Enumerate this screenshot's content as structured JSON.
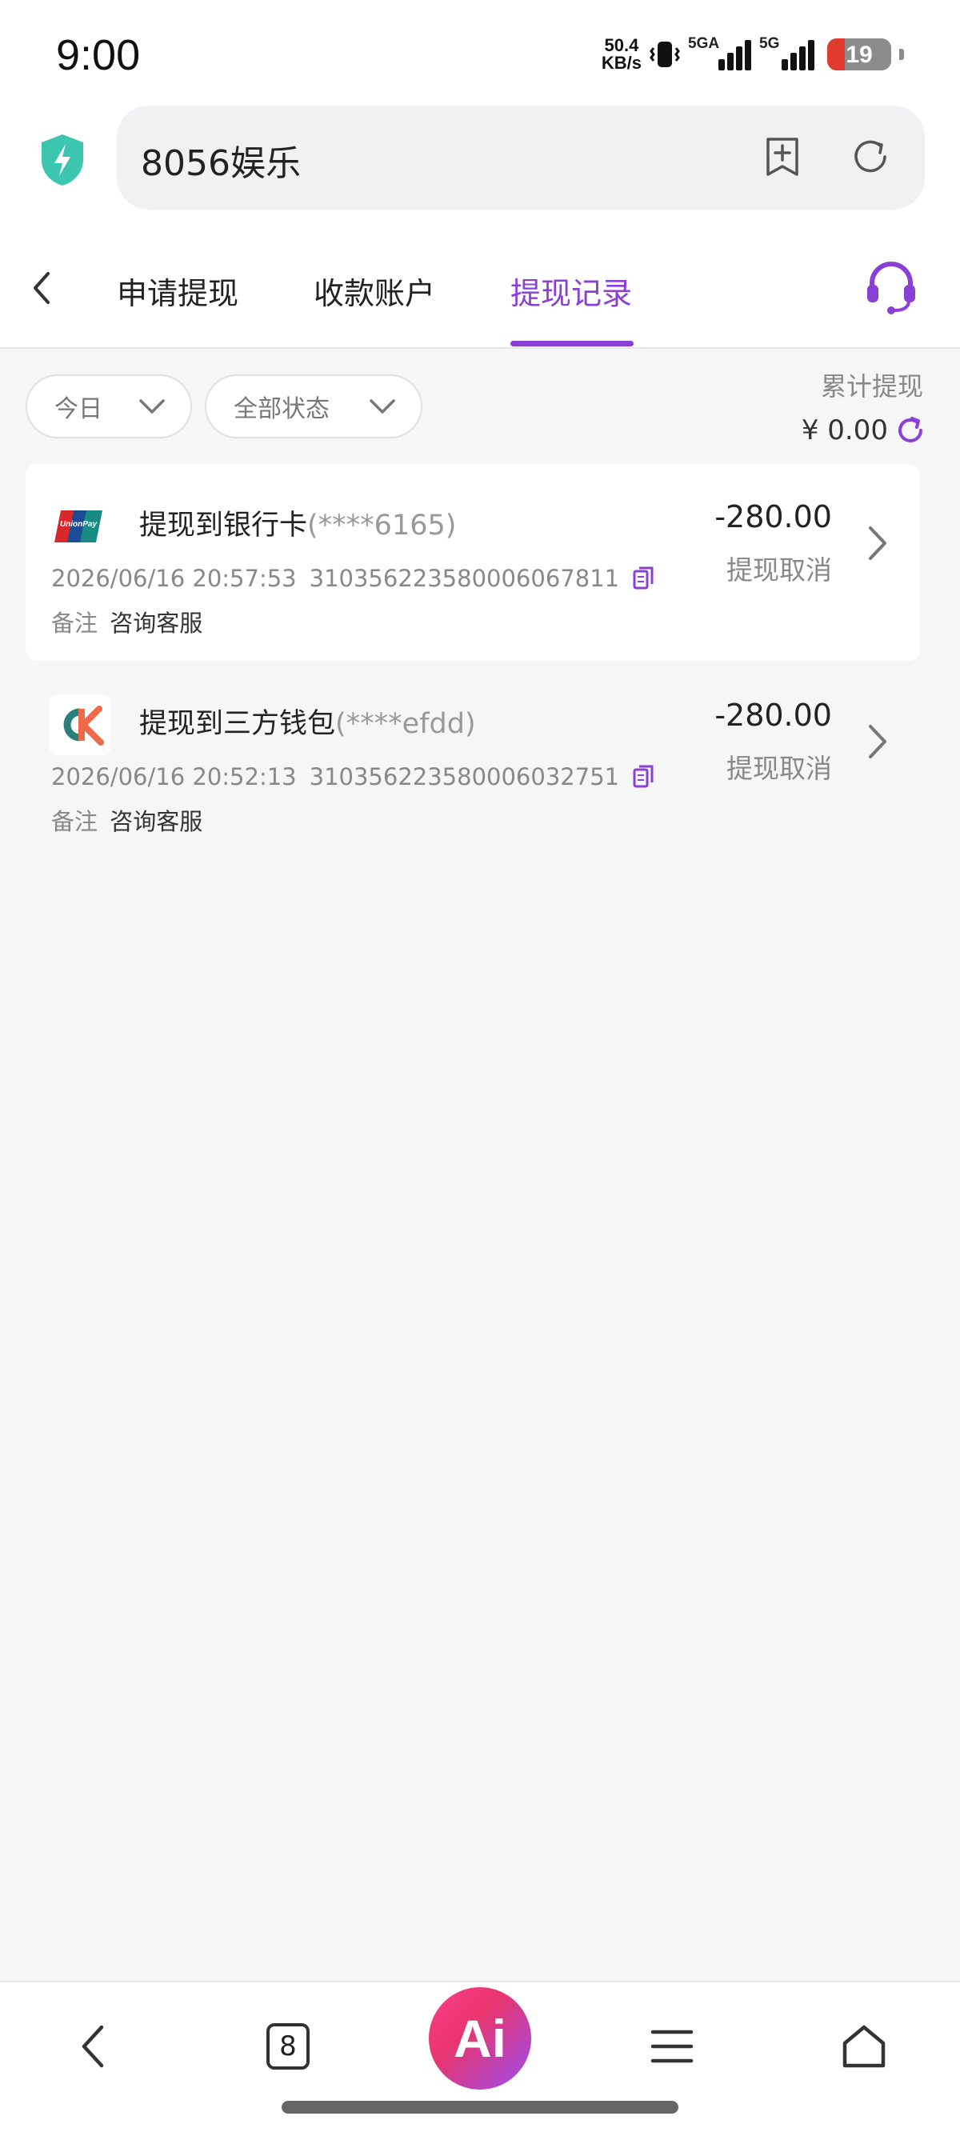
{
  "status_bar": {
    "time": "9:00",
    "net_speed_value": "50.4",
    "net_speed_unit": "KB/s",
    "signal1_label": "5GA",
    "signal2_label": "5G",
    "battery": "19",
    "battery_level": 0.19,
    "battery_low_color": "#e23a2f"
  },
  "browser": {
    "address": "8056娱乐",
    "shield_color": "#3cc6b0"
  },
  "tabs": [
    {
      "label": "申请提现",
      "active": false
    },
    {
      "label": "收款账户",
      "active": false
    },
    {
      "label": "提现记录",
      "active": true
    }
  ],
  "accent_color": "#8a3fd6",
  "filters": {
    "date": "今日",
    "status": "全部状态"
  },
  "summary": {
    "label": "累计提现",
    "value": "¥ 0.00"
  },
  "records": [
    {
      "icon": "unionpay-icon",
      "title": "提现到银行卡",
      "masked_account": "(****6165)",
      "datetime": "2026/06/16 20:57:53",
      "order_no": "310356223580006067811",
      "note_label": "备注",
      "note_value": "咨询客服",
      "amount": "-280.00",
      "status": "提现取消"
    },
    {
      "icon": "ck-wallet-icon",
      "title": "提现到三方钱包",
      "masked_account": "(****efdd)",
      "datetime": "2026/06/16 20:52:13",
      "order_no": "310356223580006032751",
      "note_label": "备注",
      "note_value": "咨询客服",
      "amount": "-280.00",
      "status": "提现取消"
    }
  ],
  "bottom_nav": {
    "tabs_count": "8",
    "ai_label": "Ai"
  }
}
